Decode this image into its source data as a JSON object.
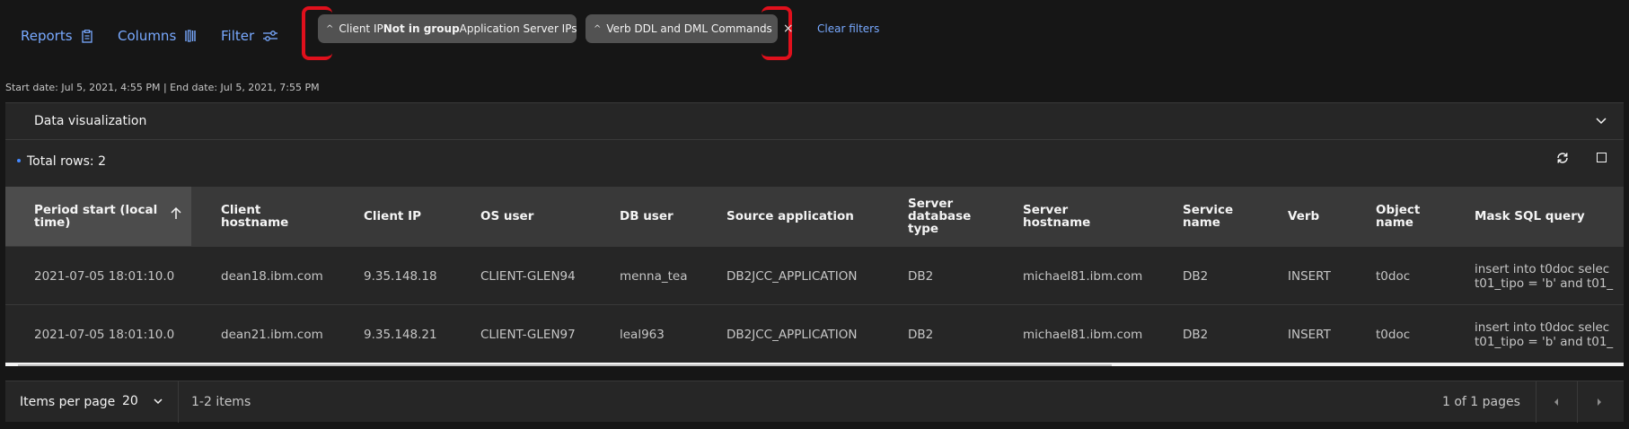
{
  "toolbar": {
    "reports_label": "Reports",
    "columns_label": "Columns",
    "filter_label": "Filter",
    "clear_filters_label": "Clear filters"
  },
  "filter_chips": [
    {
      "prefix": "Client IP ",
      "bold": "Not in group",
      "suffix": " Application Server IPs"
    },
    {
      "prefix": "Verb DDL and DML Commands",
      "bold": "",
      "suffix": ""
    }
  ],
  "date_range": "Start date: Jul 5, 2021, 4:55 PM | End date: Jul 5, 2021, 7:55 PM",
  "data_visualization_label": "Data visualization",
  "total_rows_label": "Total rows: 2",
  "table": {
    "headers": [
      [
        "Period start (local",
        "time)"
      ],
      [
        "Client",
        "hostname"
      ],
      [
        "Client IP"
      ],
      [
        "OS user"
      ],
      [
        "DB user"
      ],
      [
        "Source application"
      ],
      [
        "Server",
        "database",
        "type"
      ],
      [
        "Server",
        "hostname"
      ],
      [
        "Service",
        "name"
      ],
      [
        "Verb"
      ],
      [
        "Object",
        "name"
      ],
      [
        "Mask SQL query"
      ]
    ],
    "rows": [
      {
        "period_start": "2021-07-05 18:01:10.0",
        "client_hostname": "dean18.ibm.com",
        "client_ip": "9.35.148.18",
        "os_user": "CLIENT-GLEN94",
        "db_user": "menna_tea",
        "source_application": "DB2JCC_APPLICATION",
        "server_db_type": "DB2",
        "server_hostname": "michael81.ibm.com",
        "service_name": "DB2",
        "verb": "INSERT",
        "object_name": "t0doc",
        "sql_line1": "insert into t0doc selec",
        "sql_line2": "t01_tipo = 'b' and t01_"
      },
      {
        "period_start": "2021-07-05 18:01:10.0",
        "client_hostname": "dean21.ibm.com",
        "client_ip": "9.35.148.21",
        "os_user": "CLIENT-GLEN97",
        "db_user": "leal963",
        "source_application": "DB2JCC_APPLICATION",
        "server_db_type": "DB2",
        "server_hostname": "michael81.ibm.com",
        "service_name": "DB2",
        "verb": "INSERT",
        "object_name": "t0doc",
        "sql_line1": "insert into t0doc selec",
        "sql_line2": "t01_tipo = 'b' and t01_"
      }
    ]
  },
  "pagination": {
    "items_per_page_label": "Items per page",
    "items_per_page_value": "20",
    "range_text": "1-2 items",
    "pages_text": "1 of 1 pages"
  },
  "icons": {
    "reports": "clipboard-icon",
    "columns": "column-bars-icon",
    "filter": "sliders-icon",
    "refresh": "refresh-icon",
    "maximize": "maximize-icon"
  },
  "colors": {
    "link": "#78a9ff",
    "annotation_red": "#e0101c",
    "chip_bg": "#525252"
  }
}
